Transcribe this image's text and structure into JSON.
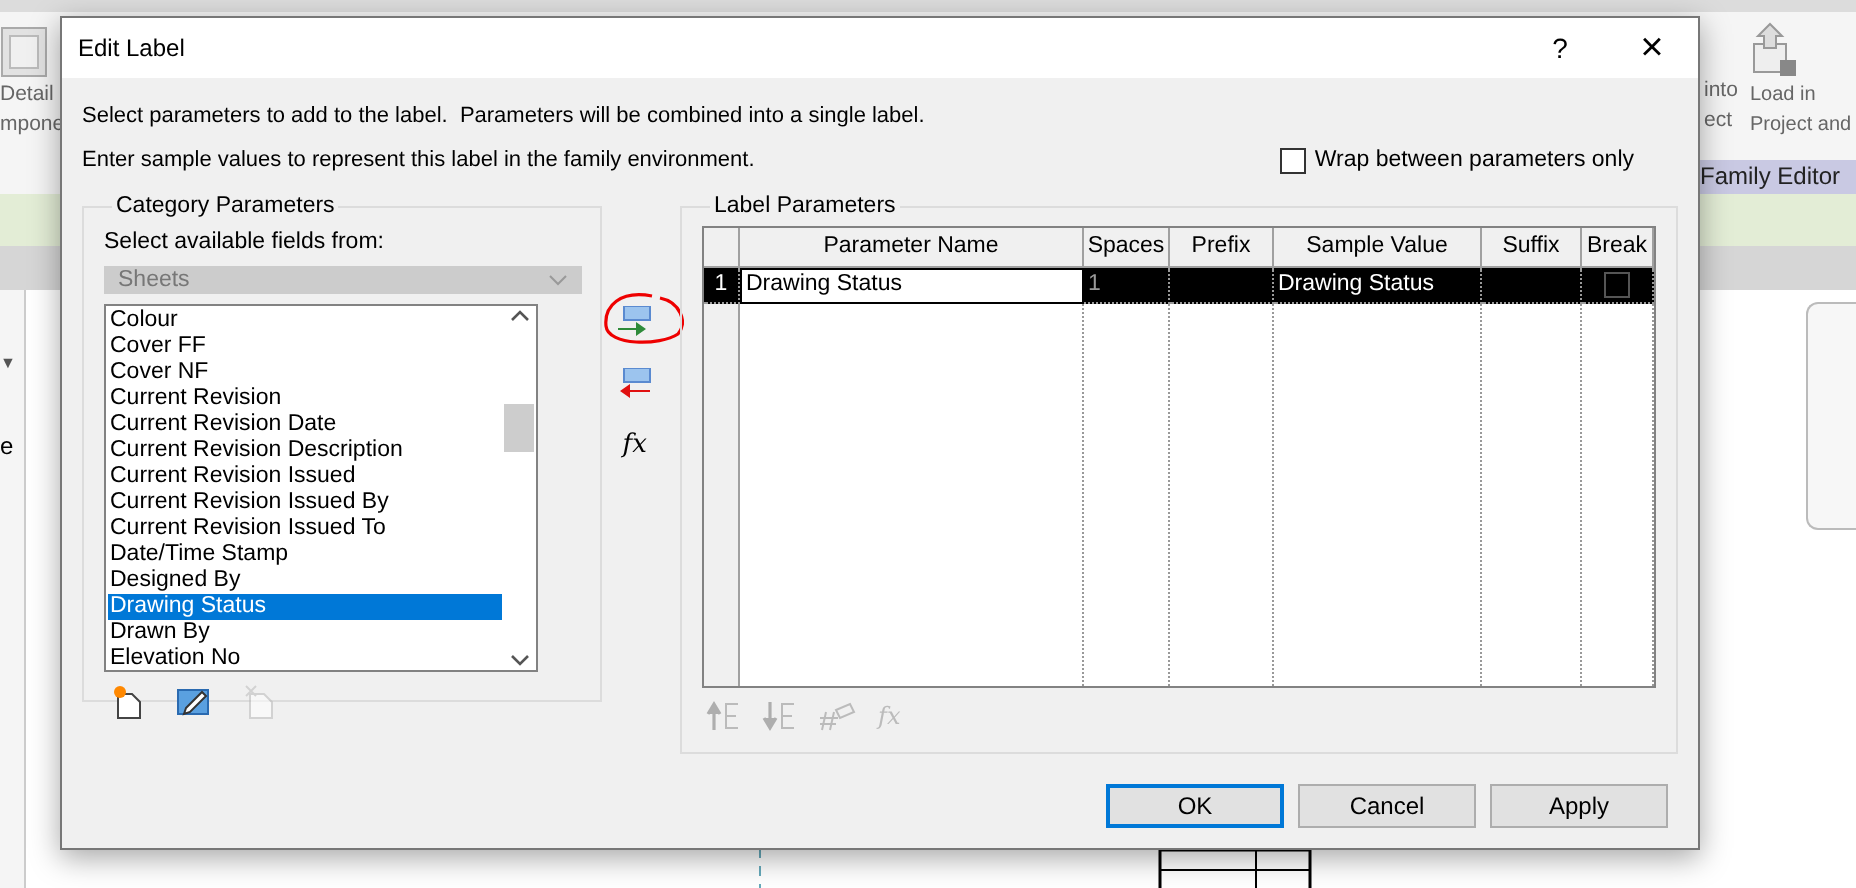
{
  "background_app": {
    "left_tool": [
      "Detail",
      "mpone"
    ],
    "right_tool_a": [
      "into",
      "ect"
    ],
    "right_tool_b": [
      "Load in",
      "Project and"
    ],
    "panel_title": "Family Editor",
    "side_text": "e",
    "side_caret": "▼"
  },
  "dialog": {
    "title": "Edit Label",
    "help": "?",
    "close": "×",
    "instructions": [
      "Select parameters to add to the label.  Parameters will be combined into a single label.",
      "Enter sample values to represent this label in the family environment."
    ],
    "wrap": {
      "label": "Wrap between parameters only",
      "checked": false
    },
    "category": {
      "title": "Category Parameters",
      "prompt": "Select available fields from:",
      "source": {
        "value": "Sheets",
        "disabled": true
      },
      "fields": [
        {
          "label": "Colour",
          "selected": false
        },
        {
          "label": "Cover FF",
          "selected": false
        },
        {
          "label": "Cover NF",
          "selected": false
        },
        {
          "label": "Current Revision",
          "selected": false
        },
        {
          "label": "Current Revision Date",
          "selected": false
        },
        {
          "label": "Current Revision Description",
          "selected": false
        },
        {
          "label": "Current Revision Issued",
          "selected": false
        },
        {
          "label": "Current Revision Issued By",
          "selected": false
        },
        {
          "label": "Current Revision Issued To",
          "selected": false
        },
        {
          "label": "Date/Time Stamp",
          "selected": false
        },
        {
          "label": "Designed By",
          "selected": false
        },
        {
          "label": "Drawing Status",
          "selected": true
        },
        {
          "label": "Drawn By",
          "selected": false
        },
        {
          "label": "Elevation No",
          "selected": false
        }
      ],
      "tools": [
        {
          "kind": "new",
          "disabled": false
        },
        {
          "kind": "edit",
          "disabled": false
        },
        {
          "kind": "delete",
          "disabled": true
        }
      ]
    },
    "transfer": [
      {
        "kind": "add",
        "circled": true
      },
      {
        "kind": "remove",
        "circled": false
      },
      {
        "kind": "formula",
        "text": "fx",
        "circled": false
      }
    ],
    "label": {
      "title": "Label Parameters",
      "columns": [
        "Parameter Name",
        "Spaces",
        "Prefix",
        "Sample Value",
        "Suffix",
        "Break"
      ],
      "rows": [
        {
          "number": "1",
          "name": "Drawing Status",
          "spaces": "1",
          "sample": "Drawing Status",
          "break": false,
          "selected": true
        }
      ],
      "tools": [
        {
          "kind": "move-up",
          "disabled": true
        },
        {
          "kind": "move-down",
          "disabled": true
        },
        {
          "kind": "number",
          "disabled": true
        },
        {
          "kind": "formula",
          "text": "fx",
          "disabled": true
        }
      ]
    },
    "buttons": [
      {
        "label": "OK",
        "default": true
      },
      {
        "label": "Cancel",
        "default": false
      },
      {
        "label": "Apply",
        "default": false
      }
    ]
  }
}
